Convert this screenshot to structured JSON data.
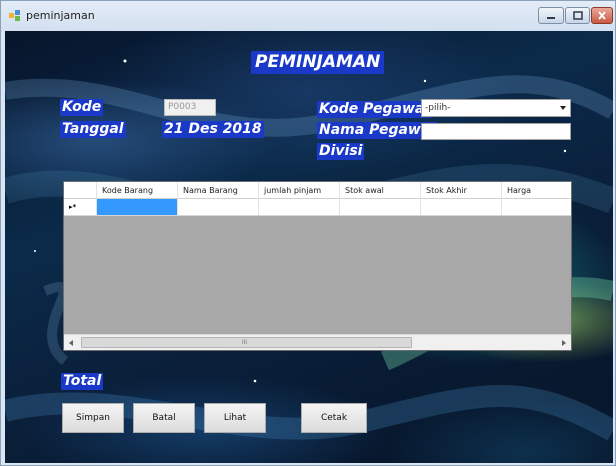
{
  "window": {
    "title": "peminjaman",
    "icon": "form-icon",
    "controls": [
      "minimize-icon",
      "maximize-icon",
      "close-icon"
    ]
  },
  "header": {
    "title": "PEMINJAMAN"
  },
  "form": {
    "kode_label": "Kode",
    "kode_value": "P0003",
    "tanggal_label": "Tanggal",
    "tanggal_value": "21 Des 2018",
    "kode_pegawai_label": "Kode Pegawai",
    "kode_pegawai_value": "-pilih-",
    "nama_pegawai_label": "Nama Pegawai",
    "nama_pegawai_value": "",
    "divisi_label": "Divisi",
    "total_label": "Total"
  },
  "grid": {
    "columns": [
      "Kode Barang",
      "Nama Barang",
      "jumlah pinjam",
      "Stok awal",
      "Stok Akhir",
      "Harga"
    ],
    "new_row_marker": "▸*",
    "scroll_grip": "III"
  },
  "buttons": {
    "simpan": "Simpan",
    "batal": "Batal",
    "lihat": "Lihat",
    "cetak": "Cetak"
  },
  "colors": {
    "label_bg": "#1a39c8",
    "selected_cell": "#3399ff"
  }
}
